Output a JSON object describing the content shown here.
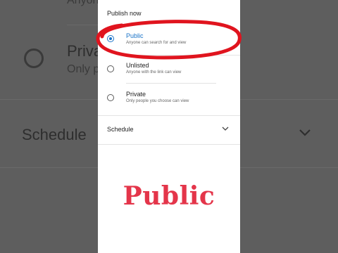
{
  "background": {
    "top_partial": "Anyone c",
    "private_partial": "Priva",
    "private_sub_partial": "Only p",
    "schedule_label": "Schedule"
  },
  "panel": {
    "title": "Publish now",
    "options": [
      {
        "label": "Public",
        "description": "Anyone can search for and view",
        "selected": true
      },
      {
        "label": "Unlisted",
        "description": "Anyone with the link can view",
        "selected": false
      },
      {
        "label": "Private",
        "description": "Only people you choose can view",
        "selected": false
      }
    ],
    "schedule": {
      "label": "Schedule",
      "icon": "chevron-down-icon"
    }
  },
  "overlay": {
    "caption": "Public",
    "color": "#e4354a"
  },
  "annotation": {
    "shape": "ellipse",
    "color": "#e0141e"
  },
  "colors": {
    "accent": "#1a73c8",
    "dim_background": "#5e5e5e"
  }
}
